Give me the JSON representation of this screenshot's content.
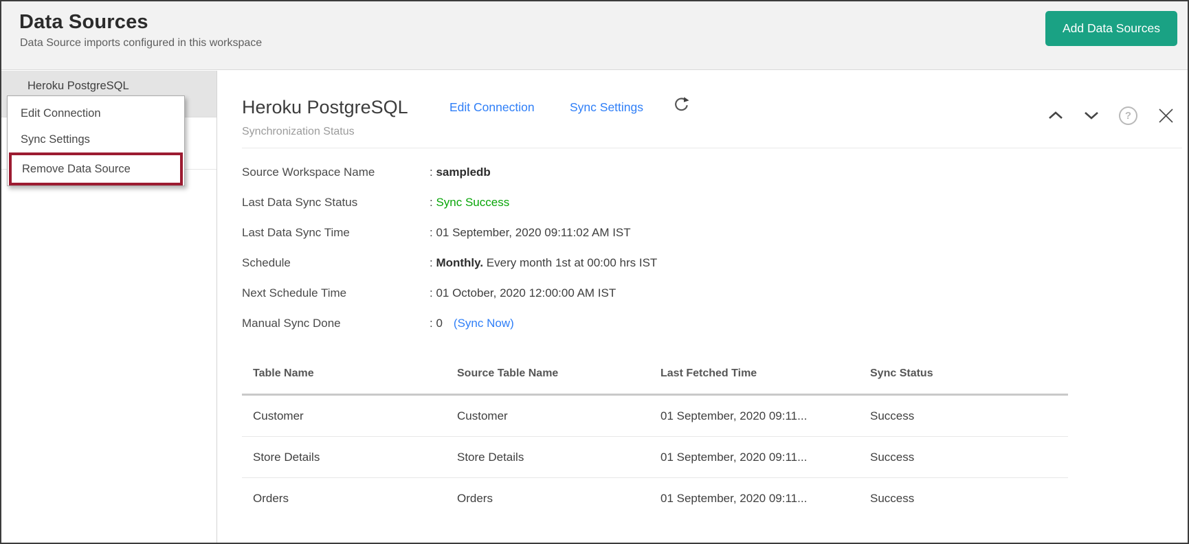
{
  "header": {
    "title": "Data Sources",
    "subtitle": "Data Source imports configured in this workspace",
    "add_button": "Add Data Sources"
  },
  "sidebar": {
    "selected_item": "Heroku PostgreSQL"
  },
  "context_menu": {
    "items": [
      {
        "label": "Edit Connection",
        "highlighted": false
      },
      {
        "label": "Sync Settings",
        "highlighted": false
      },
      {
        "label": "Remove Data Source",
        "highlighted": true
      }
    ]
  },
  "main": {
    "title": "Heroku PostgreSQL",
    "links": {
      "edit_connection": "Edit Connection",
      "sync_settings": "Sync Settings"
    },
    "section_label": "Synchronization Status",
    "sync_info": [
      {
        "label": "Source Workspace Name",
        "prefix": ": ",
        "value_bold": "sampledb"
      },
      {
        "label": "Last Data Sync Status",
        "prefix": ": ",
        "value_green": "Sync Success"
      },
      {
        "label": "Last Data Sync Time",
        "prefix": ": ",
        "value": "01 September, 2020 09:11:02 AM IST"
      },
      {
        "label": "Schedule",
        "prefix": ": ",
        "value_bold": "Monthly.",
        "value": " Every month 1st at 00:00 hrs IST"
      },
      {
        "label": "Next Schedule Time",
        "prefix": ": ",
        "value": "01 October, 2020 12:00:00 AM IST"
      },
      {
        "label": "Manual Sync Done",
        "prefix": ": ",
        "value": "0",
        "link": "(Sync Now)"
      }
    ],
    "table": {
      "headers": [
        "Table Name",
        "Source Table Name",
        "Last Fetched Time",
        "Sync Status"
      ],
      "rows": [
        [
          "Customer",
          "Customer",
          "01 September, 2020 09:11...",
          "Success"
        ],
        [
          "Store Details",
          "Store Details",
          "01 September, 2020 09:11...",
          "Success"
        ],
        [
          "Orders",
          "Orders",
          "01 September, 2020 09:11...",
          "Success"
        ]
      ]
    }
  },
  "icons": {
    "help_glyph": "?",
    "refresh": "refresh-icon",
    "collapse_up": "chevron-up-icon",
    "collapse_down": "chevron-down-icon",
    "close": "close-icon"
  },
  "colors": {
    "add_button_green": "#1aa284",
    "link_blue": "#2e7ef7",
    "success_green": "#09a509",
    "highlight_red": "#9c1b31",
    "header_bg": "#f2f2f2",
    "selected_row_bg": "#e4e4e4"
  }
}
